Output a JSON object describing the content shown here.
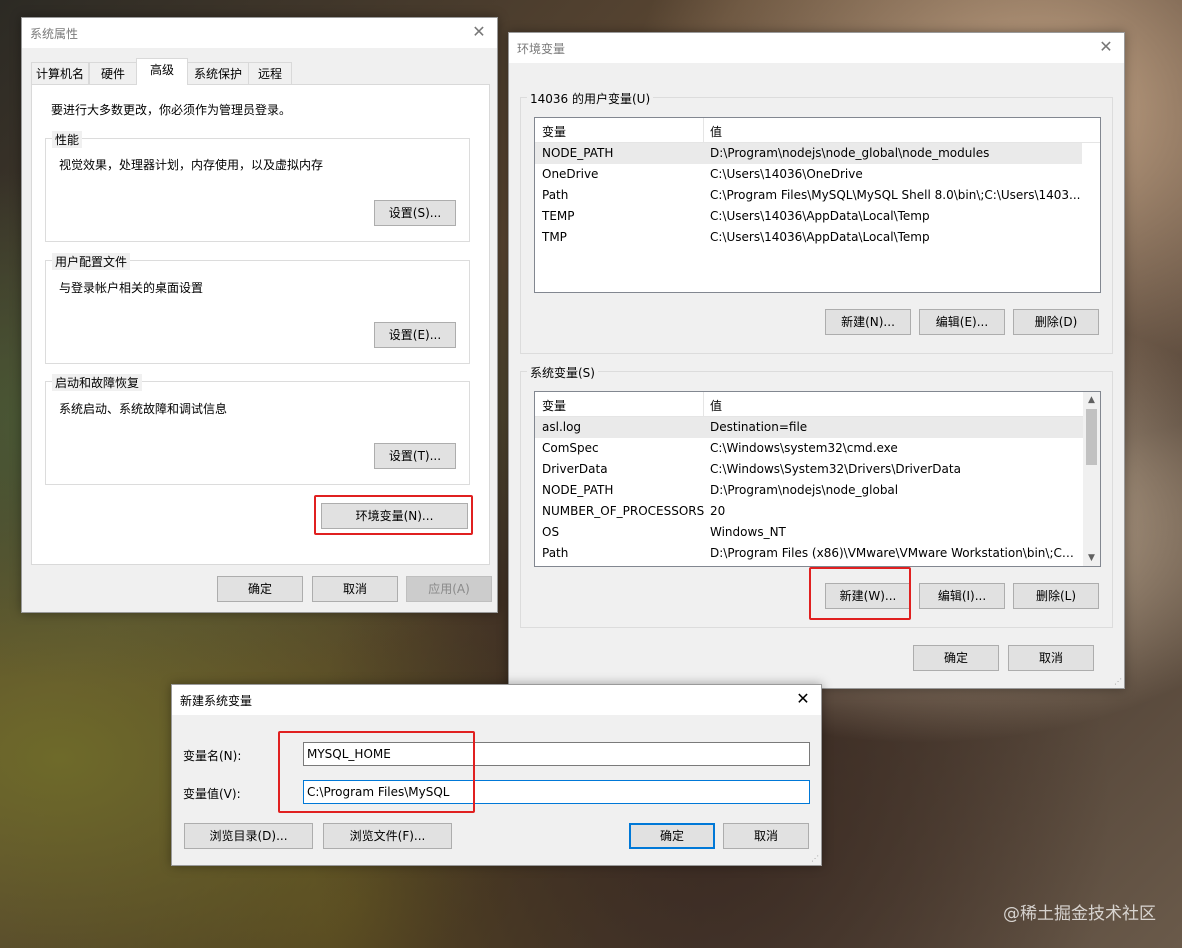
{
  "sysprops": {
    "title": "系统属性",
    "tabs": [
      "计算机名",
      "硬件",
      "高级",
      "系统保护",
      "远程"
    ],
    "active_tab": "高级",
    "admin_note": "要进行大多数更改，你必须作为管理员登录。",
    "perf": {
      "label": "性能",
      "desc": "视觉效果，处理器计划，内存使用，以及虚拟内存",
      "button": "设置(S)..."
    },
    "profile": {
      "label": "用户配置文件",
      "desc": "与登录帐户相关的桌面设置",
      "button": "设置(E)..."
    },
    "startup": {
      "label": "启动和故障恢复",
      "desc": "系统启动、系统故障和调试信息",
      "button": "设置(T)..."
    },
    "env_button": "环境变量(N)...",
    "ok": "确定",
    "cancel": "取消",
    "apply": "应用(A)"
  },
  "envvars": {
    "title": "环境变量",
    "user_group": "14036 的用户变量(U)",
    "col_var": "变量",
    "col_val": "值",
    "user_rows": [
      {
        "name": "NODE_PATH",
        "value": "D:\\Program\\nodejs\\node_global\\node_modules"
      },
      {
        "name": "OneDrive",
        "value": "C:\\Users\\14036\\OneDrive"
      },
      {
        "name": "Path",
        "value": "C:\\Program Files\\MySQL\\MySQL Shell 8.0\\bin\\;C:\\Users\\1403..."
      },
      {
        "name": "TEMP",
        "value": "C:\\Users\\14036\\AppData\\Local\\Temp"
      },
      {
        "name": "TMP",
        "value": "C:\\Users\\14036\\AppData\\Local\\Temp"
      }
    ],
    "user_buttons": {
      "new": "新建(N)...",
      "edit": "编辑(E)...",
      "delete": "删除(D)"
    },
    "sys_group": "系统变量(S)",
    "sys_rows": [
      {
        "name": "asl.log",
        "value": "Destination=file"
      },
      {
        "name": "ComSpec",
        "value": "C:\\Windows\\system32\\cmd.exe"
      },
      {
        "name": "DriverData",
        "value": "C:\\Windows\\System32\\Drivers\\DriverData"
      },
      {
        "name": "NODE_PATH",
        "value": "D:\\Program\\nodejs\\node_global"
      },
      {
        "name": "NUMBER_OF_PROCESSORS",
        "value": "20"
      },
      {
        "name": "OS",
        "value": "Windows_NT"
      },
      {
        "name": "Path",
        "value": "D:\\Program Files (x86)\\VMware\\VMware Workstation\\bin\\;C:\\..."
      }
    ],
    "sys_buttons": {
      "new": "新建(W)...",
      "edit": "编辑(I)...",
      "delete": "删除(L)"
    },
    "ok": "确定",
    "cancel": "取消"
  },
  "newvar": {
    "title": "新建系统变量",
    "name_label": "变量名(N):",
    "name_value": "MYSQL_HOME",
    "value_label": "变量值(V):",
    "value_value": "C:\\Program Files\\MySQL",
    "browse_dir": "浏览目录(D)...",
    "browse_file": "浏览文件(F)...",
    "ok": "确定",
    "cancel": "取消"
  },
  "watermark": "@稀土掘金技术社区"
}
